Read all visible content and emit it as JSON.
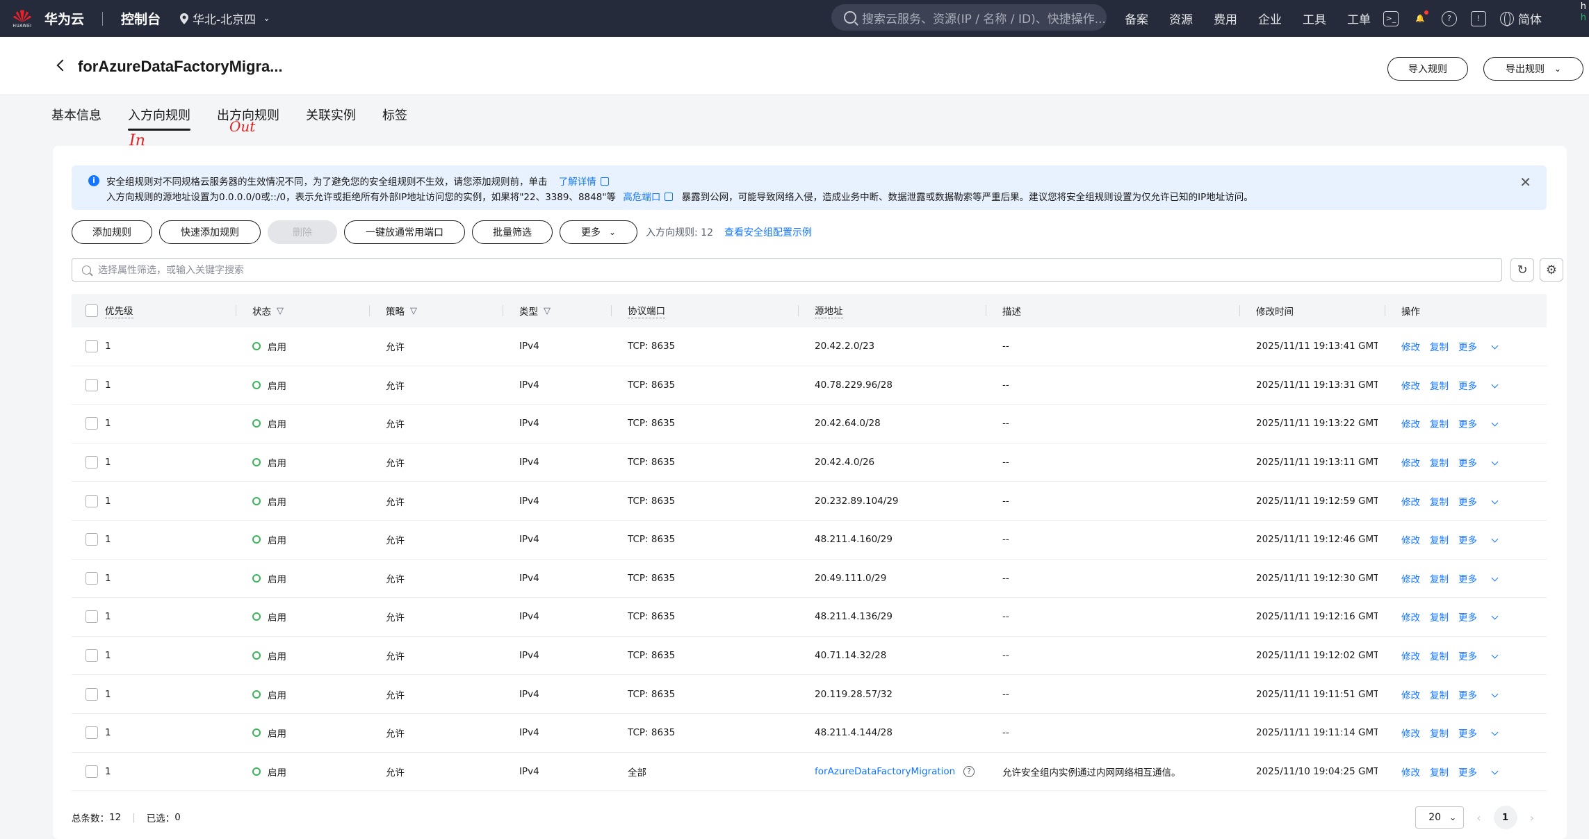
{
  "topbar": {
    "logo_text": "HUAWEI",
    "brand": "华为云",
    "console": "控制台",
    "region": "华北-北京四",
    "search_placeholder": "搜索云服务、资源(IP / 名称 / ID)、快捷操作...",
    "nav": [
      "备案",
      "资源",
      "费用",
      "企业",
      "工具",
      "工单"
    ],
    "language": "简体",
    "edge_text": [
      "h",
      "h"
    ]
  },
  "header": {
    "title": "forAzureDataFactoryMigra...",
    "import_button": "导入规则",
    "export_button": "导出规则"
  },
  "tabs": [
    "基本信息",
    "入方向规则",
    "出方向规则",
    "关联实例",
    "标签"
  ],
  "annotations": {
    "in": "In",
    "out": "Out"
  },
  "alert": {
    "line1": "安全组规则对不同规格云服务器的生效情况不同，为了避免您的安全组规则不生效，请您添加规则前，单击",
    "line1_link": "了解详情",
    "line2_a": "入方向规则的源地址设置为0.0.0.0/0或::/0，表示允许或拒绝所有外部IP地址访问您的实例，如果将\"22、3389、8848\"等",
    "line2_link": "高危端口",
    "line2_b": "暴露到公网，可能导致网络入侵，造成业务中断、数据泄露或数据勒索等严重后果。建议您将安全组规则设置为仅允许已知的IP地址访问。"
  },
  "toolbar": {
    "add": "添加规则",
    "quick_add": "快速添加规则",
    "delete": "删除",
    "allow_common": "一键放通常用端口",
    "batch_filter": "批量筛选",
    "more": "更多",
    "count_label": "入方向规则: 12",
    "example_link": "查看安全组配置示例"
  },
  "filter_placeholder": "选择属性筛选，或输入关键字搜索",
  "columns": {
    "priority": "优先级",
    "status": "状态",
    "policy": "策略",
    "type": "类型",
    "port": "协议端口",
    "source": "源地址",
    "desc": "描述",
    "modified": "修改时间",
    "ops": "操作"
  },
  "op_labels": {
    "edit": "修改",
    "copy": "复制",
    "more": "更多"
  },
  "rows": [
    {
      "priority": "1",
      "status": "启用",
      "policy": "允许",
      "type": "IPv4",
      "port": "TCP: 8635",
      "source": "20.42.2.0/23",
      "desc": "--",
      "modified": "2025/11/11 19:13:41 GMT..."
    },
    {
      "priority": "1",
      "status": "启用",
      "policy": "允许",
      "type": "IPv4",
      "port": "TCP: 8635",
      "source": "40.78.229.96/28",
      "desc": "--",
      "modified": "2025/11/11 19:13:31 GMT..."
    },
    {
      "priority": "1",
      "status": "启用",
      "policy": "允许",
      "type": "IPv4",
      "port": "TCP: 8635",
      "source": "20.42.64.0/28",
      "desc": "--",
      "modified": "2025/11/11 19:13:22 GMT..."
    },
    {
      "priority": "1",
      "status": "启用",
      "policy": "允许",
      "type": "IPv4",
      "port": "TCP: 8635",
      "source": "20.42.4.0/26",
      "desc": "--",
      "modified": "2025/11/11 19:13:11 GMT..."
    },
    {
      "priority": "1",
      "status": "启用",
      "policy": "允许",
      "type": "IPv4",
      "port": "TCP: 8635",
      "source": "20.232.89.104/29",
      "desc": "--",
      "modified": "2025/11/11 19:12:59 GMT..."
    },
    {
      "priority": "1",
      "status": "启用",
      "policy": "允许",
      "type": "IPv4",
      "port": "TCP: 8635",
      "source": "48.211.4.160/29",
      "desc": "--",
      "modified": "2025/11/11 19:12:46 GMT..."
    },
    {
      "priority": "1",
      "status": "启用",
      "policy": "允许",
      "type": "IPv4",
      "port": "TCP: 8635",
      "source": "20.49.111.0/29",
      "desc": "--",
      "modified": "2025/11/11 19:12:30 GMT..."
    },
    {
      "priority": "1",
      "status": "启用",
      "policy": "允许",
      "type": "IPv4",
      "port": "TCP: 8635",
      "source": "48.211.4.136/29",
      "desc": "--",
      "modified": "2025/11/11 19:12:16 GMT..."
    },
    {
      "priority": "1",
      "status": "启用",
      "policy": "允许",
      "type": "IPv4",
      "port": "TCP: 8635",
      "source": "40.71.14.32/28",
      "desc": "--",
      "modified": "2025/11/11 19:12:02 GMT..."
    },
    {
      "priority": "1",
      "status": "启用",
      "policy": "允许",
      "type": "IPv4",
      "port": "TCP: 8635",
      "source": "20.119.28.57/32",
      "desc": "--",
      "modified": "2025/11/11 19:11:51 GMT..."
    },
    {
      "priority": "1",
      "status": "启用",
      "policy": "允许",
      "type": "IPv4",
      "port": "TCP: 8635",
      "source": "48.211.4.144/28",
      "desc": "--",
      "modified": "2025/11/11 19:11:14 GMT..."
    },
    {
      "priority": "1",
      "status": "启用",
      "policy": "允许",
      "type": "IPv4",
      "port": "全部",
      "source": "forAzureDataFactoryMigration",
      "source_is_link": true,
      "desc": "允许安全组内实例通过内网网络相互通信。",
      "modified": "2025/11/10 19:04:25 GMT..."
    }
  ],
  "footer": {
    "total_label": "总条数：",
    "total": "12",
    "selected_label": "已选：",
    "selected": "0",
    "page_size": "20",
    "current_page": "1"
  },
  "colors": {
    "topbar": "#252b3a",
    "link": "#1476ff",
    "status_ok": "#3ab45a",
    "annotation": "#e02020"
  }
}
